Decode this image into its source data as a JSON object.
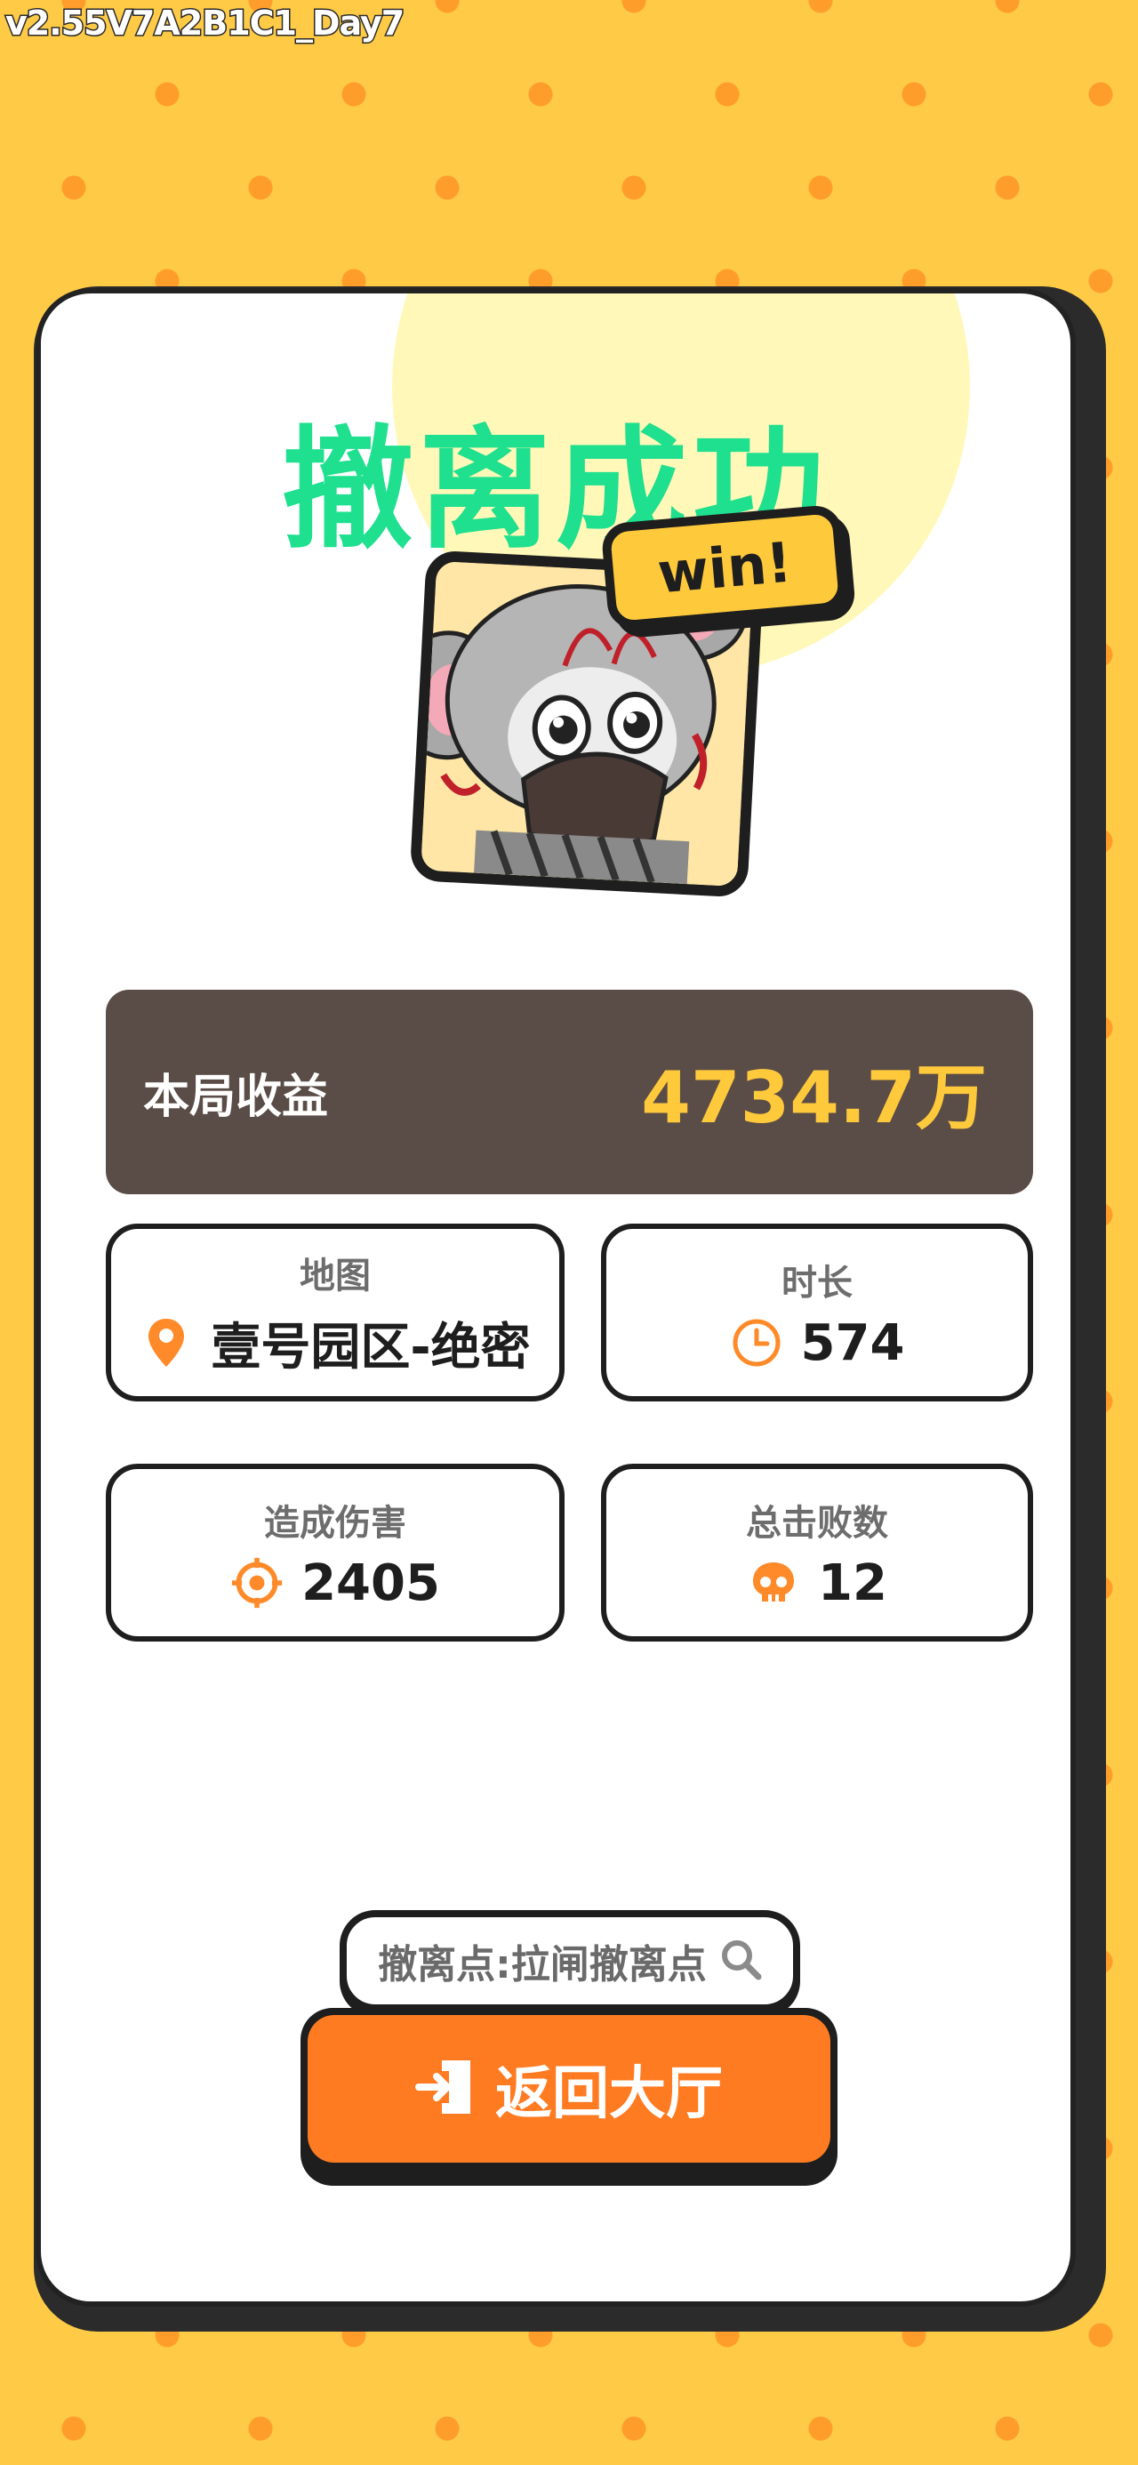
{
  "version": "v2.55V7A2B1C1_Day7",
  "title": "撤离成功",
  "badge": "win!",
  "income": {
    "label": "本局收益",
    "value": "4734.7万"
  },
  "stats": {
    "map": {
      "label": "地图",
      "value": "壹号园区-绝密",
      "icon": "location-pin-icon"
    },
    "duration": {
      "label": "时长",
      "value": "574",
      "icon": "clock-icon"
    },
    "damage": {
      "label": "造成伤害",
      "value": "2405",
      "icon": "crosshair-icon"
    },
    "kills": {
      "label": "总击败数",
      "value": "12",
      "icon": "skull-icon"
    }
  },
  "extract_point": {
    "text": "撤离点:拉闸撤离点",
    "icon": "search-icon"
  },
  "back_button": {
    "label": "返回大厅",
    "icon": "exit-icon"
  },
  "colors": {
    "background": "#FFCB47",
    "dots": "#FF9D2B",
    "title": "#1EE08E",
    "income_bg": "#5A4C46",
    "income_value": "#FFC93C",
    "icon_orange": "#FF8A2A",
    "button": "#FF7B22"
  }
}
